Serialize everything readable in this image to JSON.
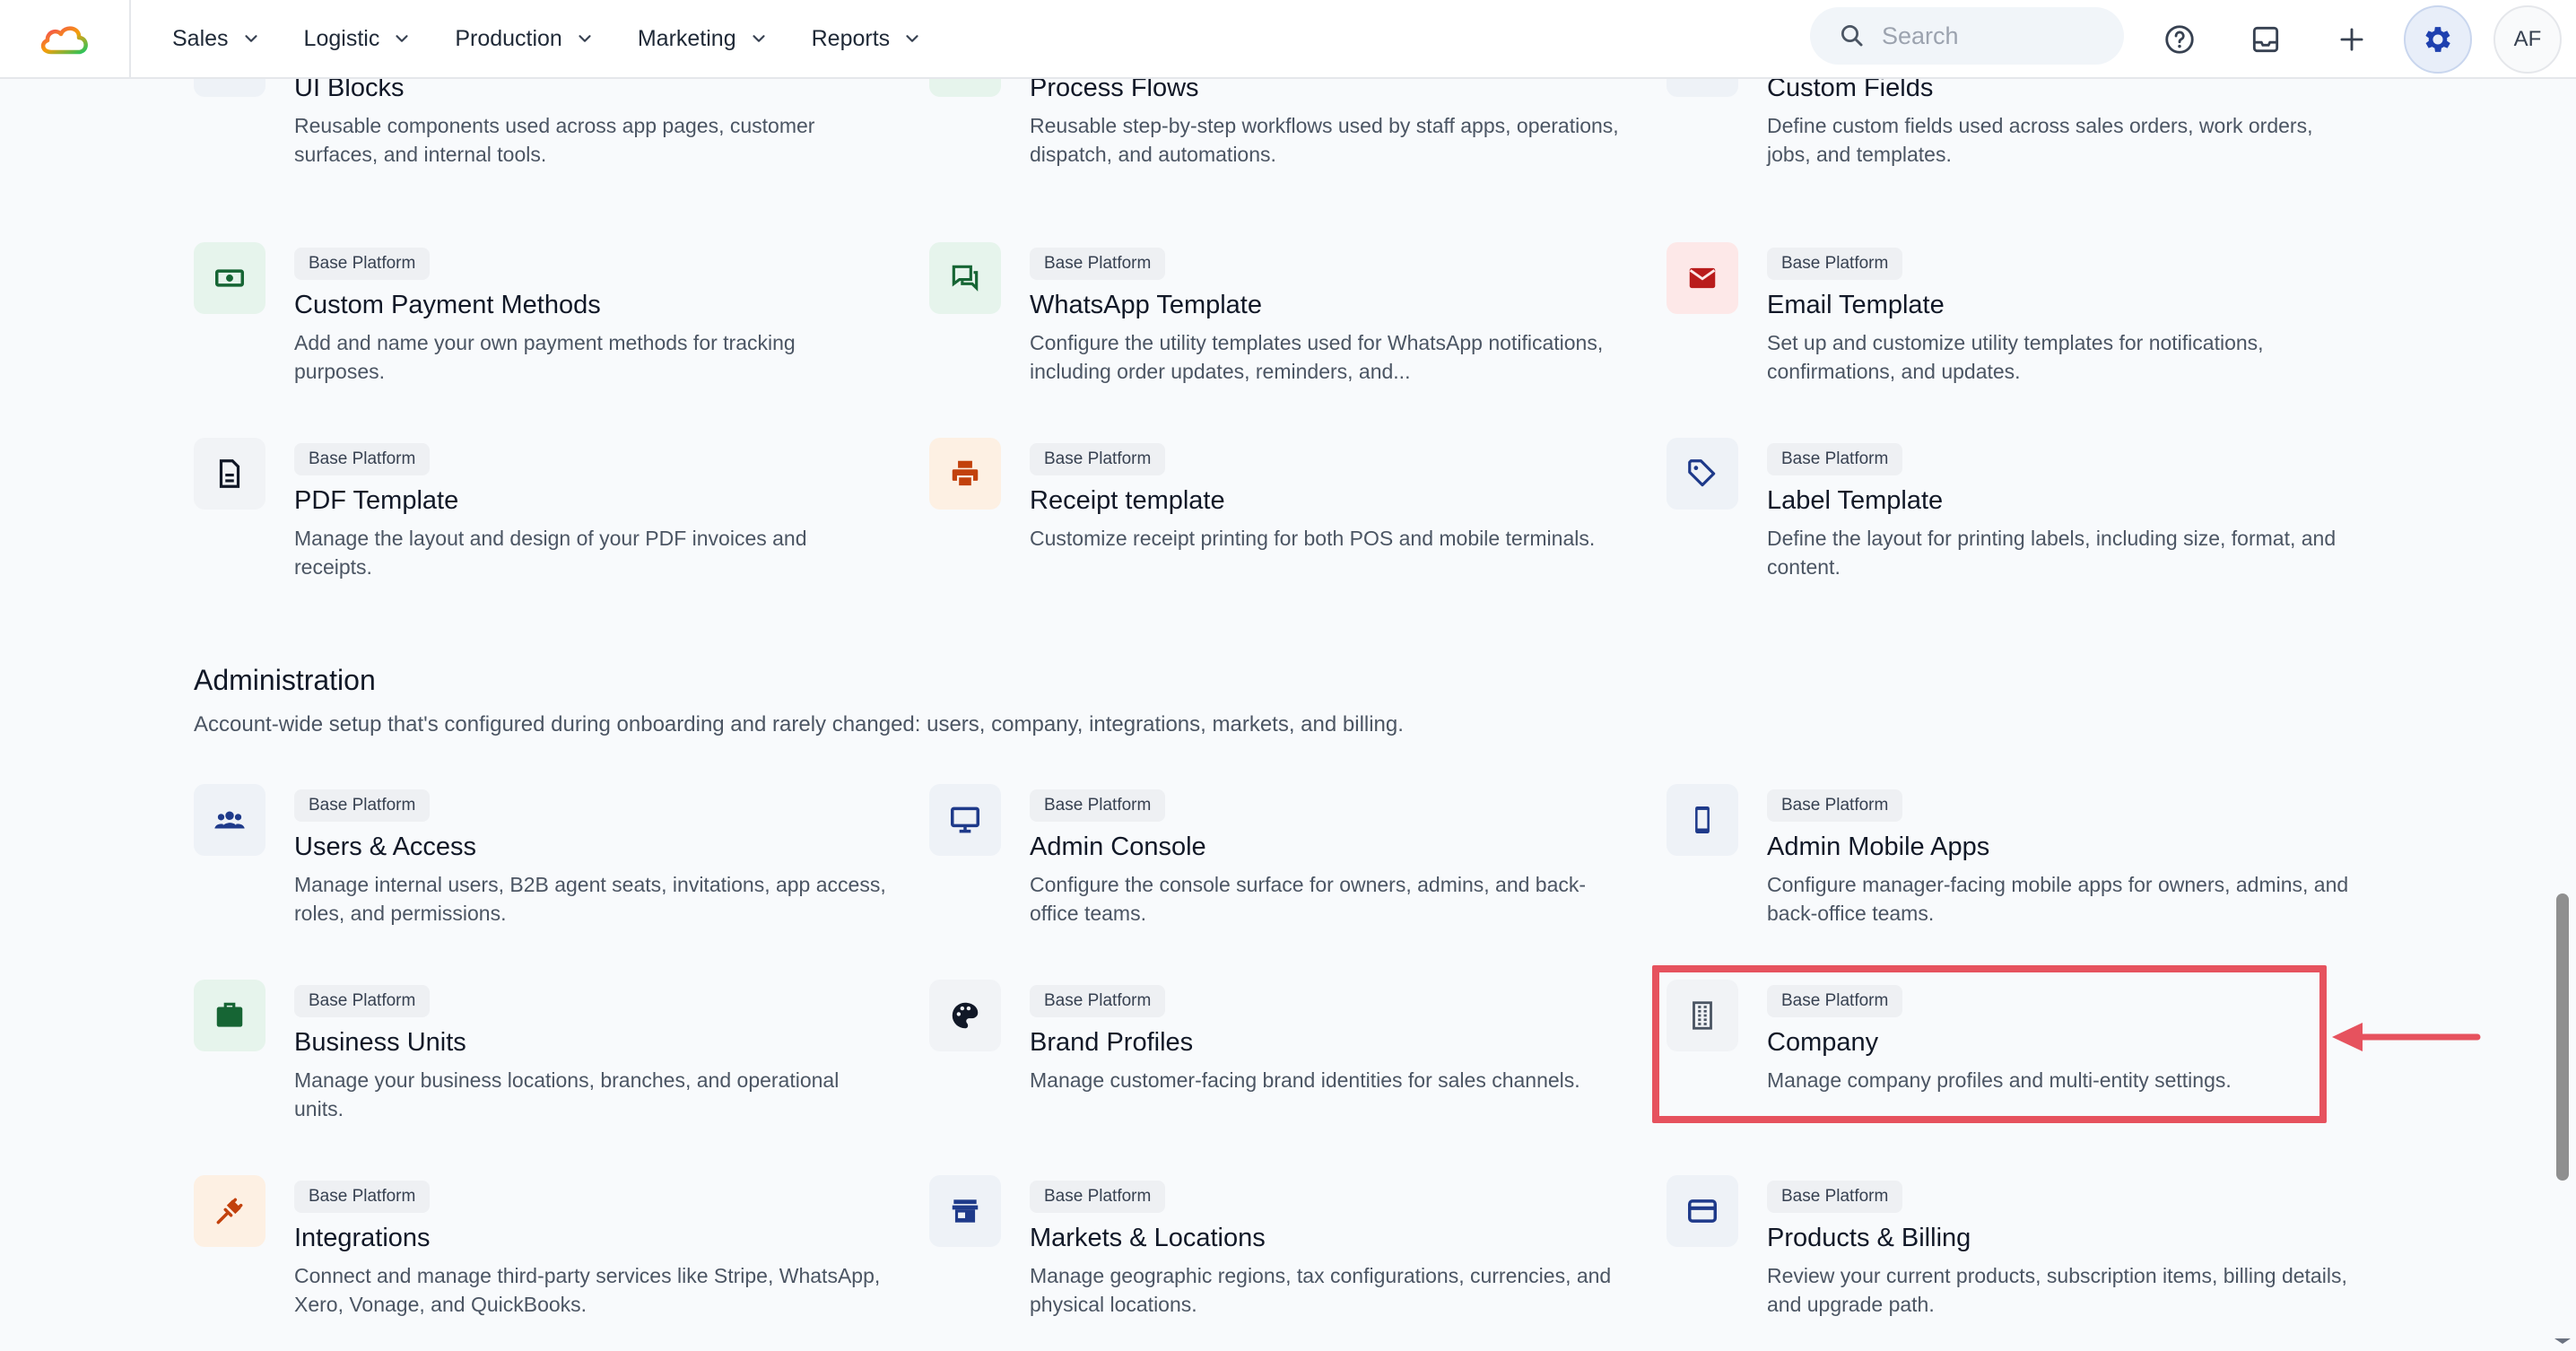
{
  "nav": {
    "items": [
      {
        "label": "Sales"
      },
      {
        "label": "Logistic"
      },
      {
        "label": "Production"
      },
      {
        "label": "Marketing"
      },
      {
        "label": "Reports"
      }
    ]
  },
  "header": {
    "search_placeholder": "Search",
    "avatar_initials": "AF"
  },
  "cards_top": [
    {
      "badge": "",
      "title": "UI Blocks",
      "desc": "Reusable components used across app pages, customer surfaces, and internal tools."
    },
    {
      "badge": "",
      "title": "Process Flows",
      "desc": "Reusable step-by-step workflows used by staff apps, operations, dispatch, and automations."
    },
    {
      "badge": "",
      "title": "Custom Fields",
      "desc": "Define custom fields used across sales orders, work orders, jobs, and templates."
    },
    {
      "badge": "Base Platform",
      "title": "Custom Payment Methods",
      "desc": "Add and name your own payment methods for tracking purposes."
    },
    {
      "badge": "Base Platform",
      "title": "WhatsApp Template",
      "desc": "Configure the utility templates used for WhatsApp notifications, including order updates, reminders, and..."
    },
    {
      "badge": "Base Platform",
      "title": "Email Template",
      "desc": "Set up and customize utility templates for notifications, confirmations, and updates."
    },
    {
      "badge": "Base Platform",
      "title": "PDF Template",
      "desc": "Manage the layout and design of your PDF invoices and receipts."
    },
    {
      "badge": "Base Platform",
      "title": "Receipt template",
      "desc": "Customize receipt printing for both POS and mobile terminals."
    },
    {
      "badge": "Base Platform",
      "title": "Label Template",
      "desc": "Define the layout for printing labels, including size, format, and content."
    }
  ],
  "administration": {
    "title": "Administration",
    "subtitle": "Account-wide setup that's configured during onboarding and rarely changed: users, company, integrations, markets, and billing.",
    "cards": [
      {
        "badge": "Base Platform",
        "title": "Users & Access",
        "desc": "Manage internal users, B2B agent seats, invitations, app access, roles, and permissions."
      },
      {
        "badge": "Base Platform",
        "title": "Admin Console",
        "desc": "Configure the console surface for owners, admins, and back-office teams."
      },
      {
        "badge": "Base Platform",
        "title": "Admin Mobile Apps",
        "desc": "Configure manager-facing mobile apps for owners, admins, and back-office teams."
      },
      {
        "badge": "Base Platform",
        "title": "Business Units",
        "desc": "Manage your business locations, branches, and operational units."
      },
      {
        "badge": "Base Platform",
        "title": "Brand Profiles",
        "desc": "Manage customer-facing brand identities for sales channels."
      },
      {
        "badge": "Base Platform",
        "title": "Company",
        "desc": "Manage company profiles and multi-entity settings."
      },
      {
        "badge": "Base Platform",
        "title": "Integrations",
        "desc": "Connect and manage third-party services like Stripe, WhatsApp, Xero, Vonage, and QuickBooks."
      },
      {
        "badge": "Base Platform",
        "title": "Markets & Locations",
        "desc": "Manage geographic regions, tax configurations, currencies, and physical locations."
      },
      {
        "badge": "Base Platform",
        "title": "Products & Billing",
        "desc": "Review your current products, subscription items, billing details, and upgrade path."
      }
    ]
  },
  "icons": {
    "ui_blocks": "blocks-icon",
    "process_flows": "flow-icon",
    "custom_fields": "edit-field-icon",
    "custom_payment": "cash-icon",
    "whatsapp": "chat-icon",
    "email": "mail-icon",
    "pdf": "document-icon",
    "receipt": "printer-icon",
    "label": "tag-icon",
    "users": "users-icon",
    "console": "monitor-icon",
    "mobile": "phone-icon",
    "business_units": "briefcase-icon",
    "brand": "palette-icon",
    "company": "building-icon",
    "integrations": "plug-icon",
    "markets": "store-icon",
    "billing": "credit-card-icon"
  },
  "colors": {
    "highlight": "#e6525e",
    "green_tile": "#e6f4ec",
    "red_tile": "#fde8e8",
    "orange_tile": "#fdf0e3",
    "blue_tile": "#eef2f7"
  }
}
